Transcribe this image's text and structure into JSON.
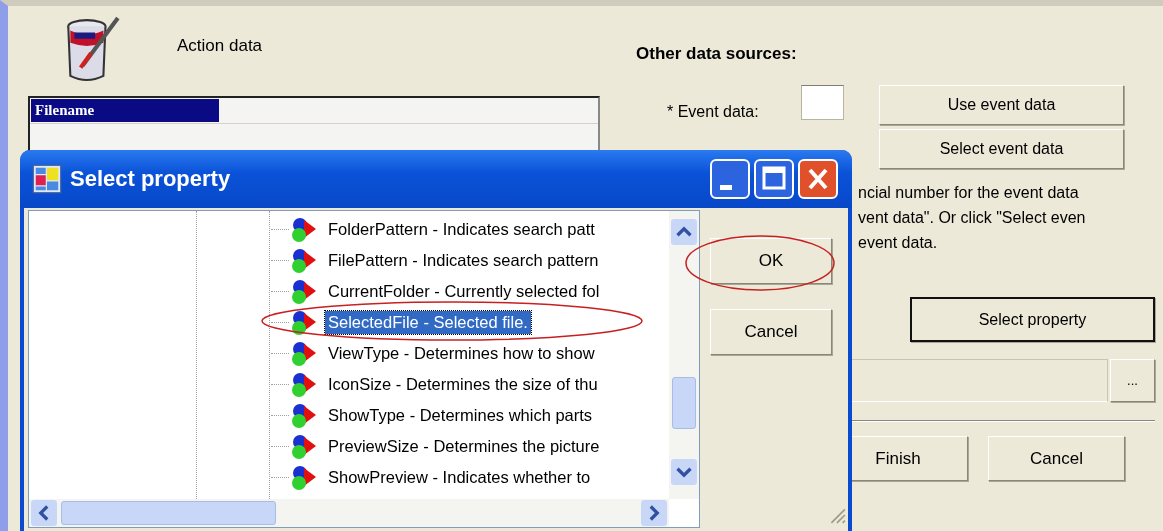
{
  "main_window": {
    "action_data_label": "Action data",
    "filename_header": {
      "label": "Filename",
      "selected": true
    },
    "other_sources_heading": "Other data sources:",
    "event_data_label": "* Event data:",
    "use_event_button": "Use event data",
    "select_event_button": "Select event data",
    "help_text_lines": [
      "ncial number for the event data",
      "vent data\". Or click \"Select even",
      "event data."
    ],
    "select_property_button": "Select property",
    "browse_button": "...",
    "finish_button": "Finish",
    "cancel_button": "Cancel"
  },
  "dialog": {
    "title": "Select property",
    "items": [
      {
        "label": "FolderPattern - Indicates search patt",
        "selected": false
      },
      {
        "label": "FilePattern - Indicates search pattern",
        "selected": false
      },
      {
        "label": "CurrentFolder - Currently selected fol",
        "selected": false
      },
      {
        "label": "SelectedFile - Selected file.",
        "selected": true
      },
      {
        "label": "ViewType - Determines how to show",
        "selected": false
      },
      {
        "label": "IconSize - Determines the size of thu",
        "selected": false
      },
      {
        "label": "ShowType - Determines which parts",
        "selected": false
      },
      {
        "label": "PreviewSize - Determines the picture",
        "selected": false
      },
      {
        "label": "ShowPreview - Indicates whether to",
        "selected": false
      }
    ],
    "ok_button": "OK",
    "cancel_button": "Cancel"
  }
}
